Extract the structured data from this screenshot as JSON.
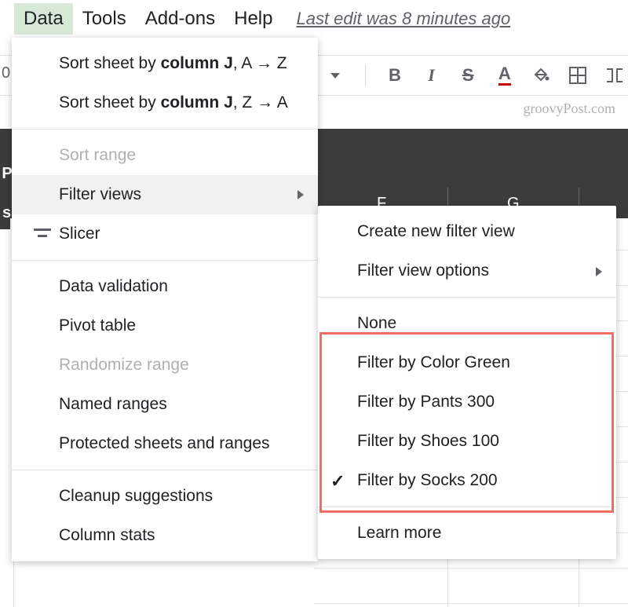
{
  "menubar": {
    "data": "Data",
    "tools": "Tools",
    "addons": "Add-ons",
    "help": "Help",
    "last_edit": "Last edit was 8 minutes ago"
  },
  "toolbar": {
    "bold": "B",
    "italic": "I",
    "strike": "S",
    "textcolor": "A"
  },
  "watermark": "groovyPost.com",
  "columns": {
    "f": "F",
    "g": "G"
  },
  "left_label_p": "P",
  "left_label_s": "s",
  "left_zero": "0",
  "menu": {
    "sort_asc_prefix": "Sort sheet by ",
    "sort_asc_bold": "column J",
    "sort_asc_suffix": ", A → Z",
    "sort_desc_prefix": "Sort sheet by ",
    "sort_desc_bold": "column J",
    "sort_desc_suffix": ", Z → A",
    "sort_range": "Sort range",
    "filter_views": "Filter views",
    "slicer": "Slicer",
    "data_validation": "Data validation",
    "pivot_table": "Pivot table",
    "randomize": "Randomize range",
    "named_ranges": "Named ranges",
    "protected": "Protected sheets and ranges",
    "cleanup": "Cleanup suggestions",
    "column_stats": "Column stats"
  },
  "submenu": {
    "create_new": "Create new filter view",
    "options": "Filter view options",
    "none": "None",
    "f1": "Filter by Color Green",
    "f2": "Filter by Pants 300",
    "f3": "Filter by Shoes 100",
    "f4": "Filter by Socks 200",
    "learn_more": "Learn more"
  }
}
